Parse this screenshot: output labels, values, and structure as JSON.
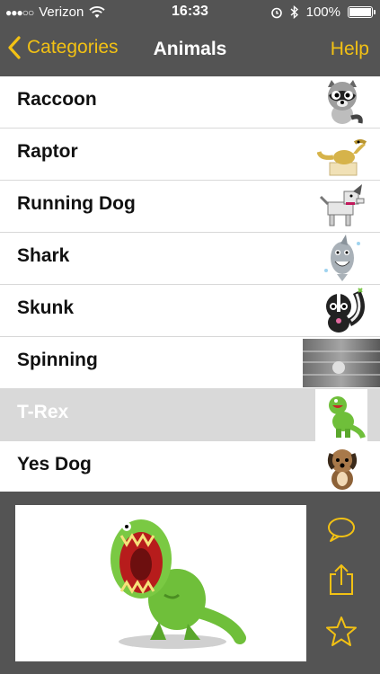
{
  "status": {
    "carrier": "Verizon",
    "signal": "●●●○○",
    "time": "16:33",
    "battery": "100%",
    "battery_level": 1.0
  },
  "nav": {
    "back_label": "Categories",
    "title": "Animals",
    "help_label": "Help"
  },
  "list": {
    "items": [
      {
        "label": "Raccoon",
        "icon": "raccoon-icon"
      },
      {
        "label": "Raptor",
        "icon": "raptor-icon"
      },
      {
        "label": "Running Dog",
        "icon": "running-dog-icon"
      },
      {
        "label": "Shark",
        "icon": "shark-icon"
      },
      {
        "label": "Skunk",
        "icon": "skunk-icon"
      },
      {
        "label": "Spinning",
        "icon": "spinning-icon"
      },
      {
        "label": "T-Rex",
        "icon": "t-rex-icon",
        "selected": true
      },
      {
        "label": "Yes Dog",
        "icon": "yes-dog-icon"
      }
    ]
  },
  "toolbar": {
    "comment_icon": "speech-bubble-icon",
    "share_icon": "share-icon",
    "favorite_icon": "star-icon"
  },
  "colors": {
    "accent": "#f2c114",
    "bar": "#545454",
    "selected_row": "#d9d9d9"
  }
}
